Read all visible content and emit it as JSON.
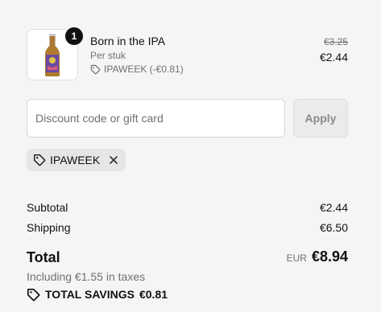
{
  "product": {
    "quantity": "1",
    "name": "Born in the IPA",
    "unit": "Per stuk",
    "discount_label": "IPAWEEK (-€0.81)",
    "original_price": "€3.25",
    "price": "€2.44",
    "image_icon": "beer-bottle-icon"
  },
  "discount": {
    "placeholder": "Discount code or gift card",
    "value": "",
    "apply_label": "Apply"
  },
  "applied_code": {
    "code": "IPAWEEK",
    "icon": "tag-icon",
    "remove_icon": "close-icon"
  },
  "summary": {
    "subtotal_label": "Subtotal",
    "subtotal_value": "€2.44",
    "shipping_label": "Shipping",
    "shipping_value": "€6.50",
    "total_label": "Total",
    "currency": "EUR",
    "total_value": "€8.94",
    "taxes_note": "Including €1.55 in taxes",
    "savings_label": "TOTAL SAVINGS",
    "savings_value": "€0.81"
  },
  "colors": {
    "background": "#f5f5f5",
    "text": "#111111",
    "muted": "#707070",
    "badge": "#111111"
  }
}
